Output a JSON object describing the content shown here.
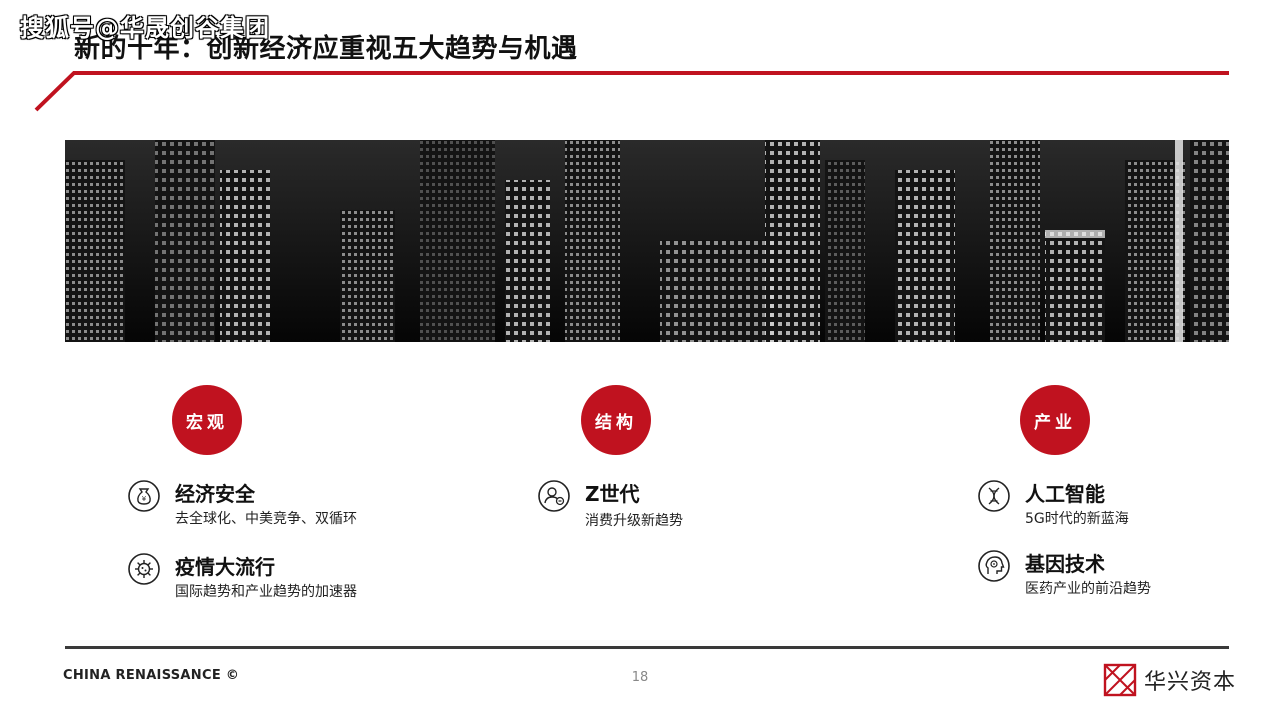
{
  "watermark": "搜狐号@华晟创谷集团",
  "title": "新的十年：创新经济应重视五大趋势与机遇",
  "sections": [
    {
      "label": "宏观",
      "items": [
        {
          "icon": "money-bag-icon",
          "name": "经济安全",
          "desc": "去全球化、中美竞争、双循环"
        },
        {
          "icon": "virus-icon",
          "name": "疫情大流行",
          "desc": "国际趋势和产业趋势的加速器"
        }
      ]
    },
    {
      "label": "结构",
      "items": [
        {
          "icon": "user-icon",
          "name": "Z世代",
          "desc": "消费升级新趋势"
        }
      ]
    },
    {
      "label": "产业",
      "items": [
        {
          "icon": "dna-icon",
          "name": "人工智能",
          "desc": "5G时代的新蓝海"
        },
        {
          "icon": "ai-head-icon",
          "name": "基因技术",
          "desc": "医药产业的前沿趋势"
        }
      ]
    }
  ],
  "footer": {
    "left": "CHINA RENAISSANCE ©",
    "page": "18",
    "brand": "华兴资本"
  },
  "colors": {
    "accent": "#c0121f",
    "rule": "#3a3a3a"
  }
}
